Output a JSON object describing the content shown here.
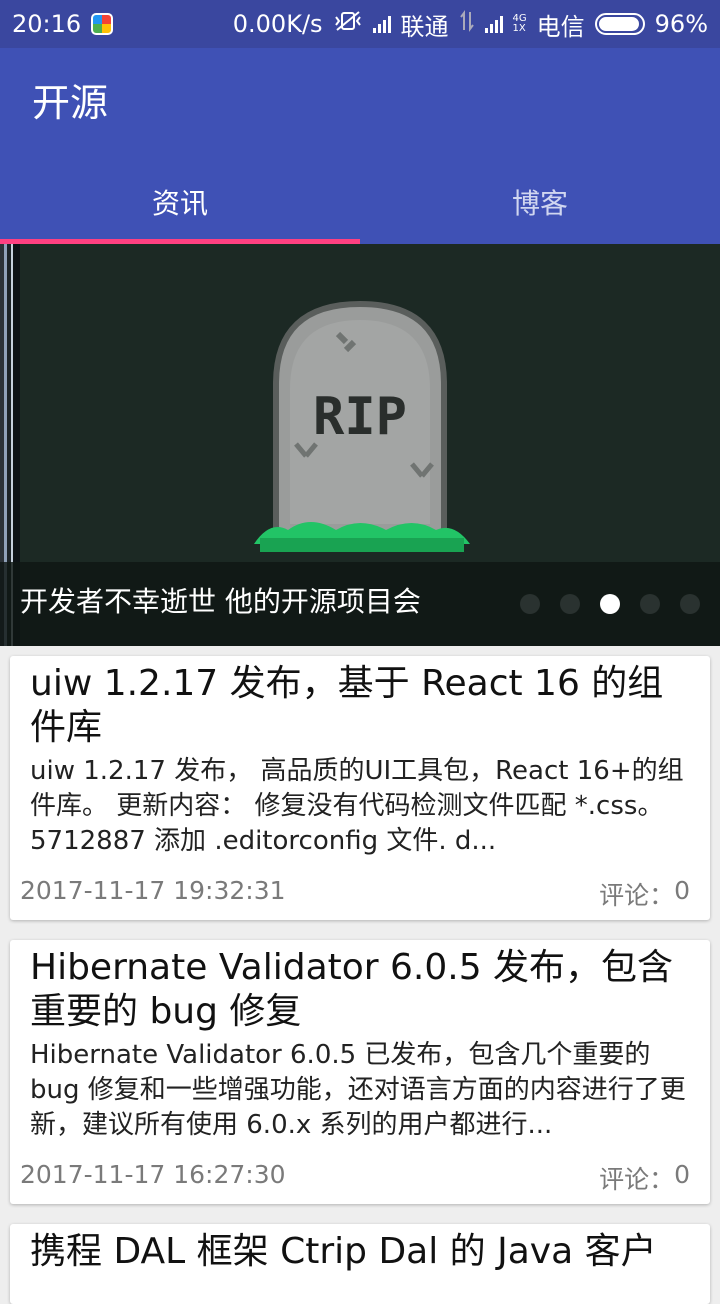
{
  "status_bar": {
    "time": "20:16",
    "net_speed": "0.00K/s",
    "carrier1": "联通",
    "carrier2": "电信",
    "net_type_top": "4G",
    "net_type_bottom": "1X",
    "battery": "96%",
    "battery_level": 0.96
  },
  "app_bar": {
    "title": "开源",
    "tabs": [
      {
        "label": "资讯",
        "selected": true
      },
      {
        "label": "博客",
        "selected": false
      }
    ],
    "indicator_color": "#ff4081",
    "primary_color": "#3f51b5"
  },
  "banner": {
    "caption": "开发者不幸逝世 他的开源项目会",
    "image_text": "RIP",
    "dots_count": 5,
    "active_dot": 2
  },
  "news": [
    {
      "title": "uiw 1.2.17 发布，基于 React 16 的组件库",
      "body": "uiw 1.2.17 发布， 高品质的UI工具包，React 16+的组件库。 更新内容： 修复没有代码检测文件匹配 *.css。 5712887 添加 .editorconfig 文件. d...",
      "time": "2017-11-17 19:32:31",
      "comment_label": "评论：",
      "comment_count": "0"
    },
    {
      "title": "Hibernate Validator 6.0.5 发布，包含重要的 bug 修复",
      "body": "Hibernate Validator 6.0.5 已发布，包含几个重要的 bug 修复和一些增强功能，还对语言方面的内容进行了更新，建议所有使用 6.0.x 系列的用户都进行...",
      "time": "2017-11-17 16:27:30",
      "comment_label": "评论：",
      "comment_count": "0"
    },
    {
      "title": "携程 DAL 框架 Ctrip Dal 的 Java 客户"
    }
  ]
}
